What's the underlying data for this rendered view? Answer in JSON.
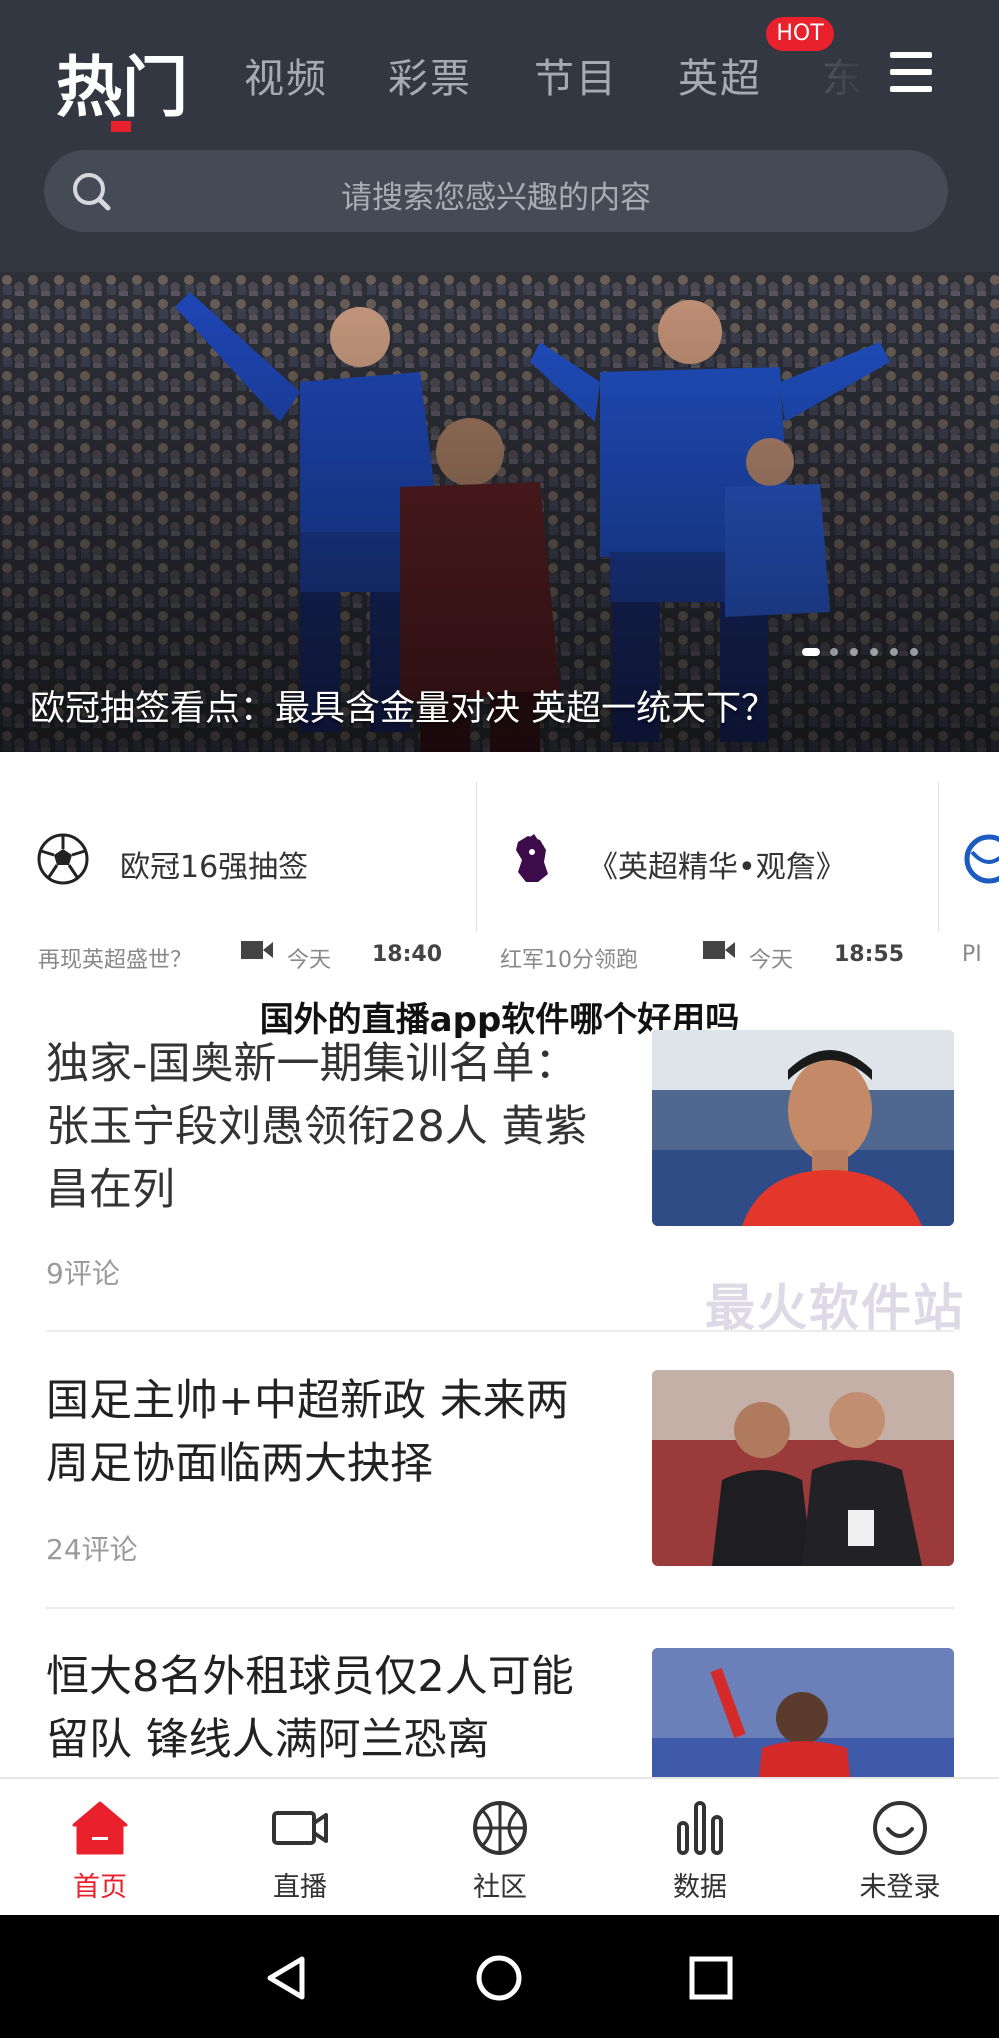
{
  "header": {
    "tabs": [
      {
        "label": "热门",
        "active": true
      },
      {
        "label": "视频"
      },
      {
        "label": "彩票"
      },
      {
        "label": "节目"
      },
      {
        "label": "英超"
      },
      {
        "label": "东"
      }
    ],
    "hot_badge": "HOT",
    "accent_color": "#e8212c",
    "menu_icon": "hamburger-menu-icon"
  },
  "search": {
    "placeholder": "请搜索您感兴趣的内容",
    "icon": "search-icon"
  },
  "banner": {
    "caption": "欧冠抽签看点：最具含金量对决 英超一统天下？",
    "slides_total": 6,
    "active_slide": 1
  },
  "topics": [
    {
      "title": "欧冠16强抽签",
      "icon": "soccer-ball-icon",
      "sub": "再现英超盛世？",
      "day": "今天",
      "time": "18:40"
    },
    {
      "title": "《英超精华•观詹》",
      "icon": "premier-league-lion-icon",
      "sub": "红军10分领跑",
      "day": "今天",
      "time": "18:55"
    },
    {
      "title": "",
      "icon": "globe-logo-icon",
      "sub": "PI",
      "day": "",
      "time": ""
    }
  ],
  "overlay_title": "国外的直播app软件哪个好用吗",
  "watermark_site": "最火软件站",
  "news": [
    {
      "title": "独家-国奥新一期集训名单：张玉宁段刘愚领衔28人 黄紫昌在列",
      "comments": "9评论"
    },
    {
      "title": "国足主帅+中超新政 未来两周足协面临两大抉择",
      "comments": "24评论"
    },
    {
      "title": "恒大8名外租球员仅2人可能留队 锋线人满阿兰恐离",
      "comments": ""
    }
  ],
  "bottom_nav": [
    {
      "label": "首页",
      "icon": "home-icon",
      "active": true
    },
    {
      "label": "直播",
      "icon": "video-camera-icon"
    },
    {
      "label": "社区",
      "icon": "basketball-icon"
    },
    {
      "label": "数据",
      "icon": "bar-chart-icon"
    },
    {
      "label": "未登录",
      "icon": "smiley-face-icon"
    }
  ],
  "system_nav": [
    "back-triangle-icon",
    "home-circle-icon",
    "recents-square-icon"
  ]
}
